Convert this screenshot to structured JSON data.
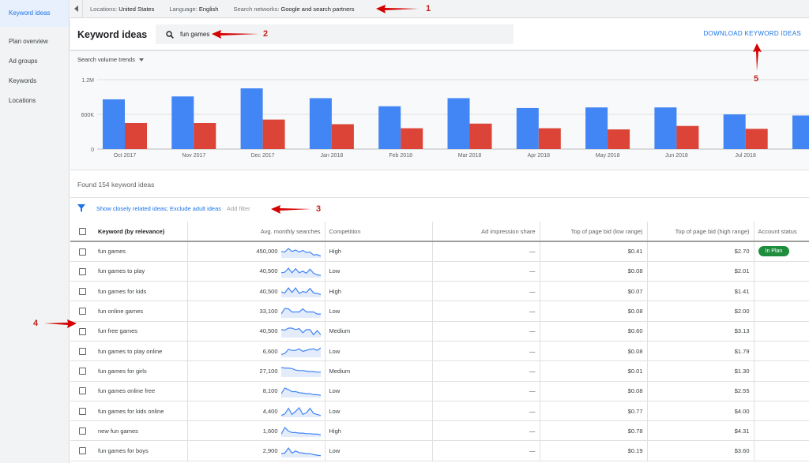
{
  "sidebar": {
    "items": [
      {
        "label": "Keyword ideas",
        "active": true
      },
      {
        "label": "Plan overview",
        "active": false
      },
      {
        "label": "Ad groups",
        "active": false
      },
      {
        "label": "Keywords",
        "active": false
      },
      {
        "label": "Locations",
        "active": false
      }
    ]
  },
  "topbar": {
    "locations_label": "Locations:",
    "locations_value": "United States",
    "language_label": "Language:",
    "language_value": "English",
    "networks_label": "Search networks:",
    "networks_value": "Google and search partners"
  },
  "header": {
    "title": "Keyword ideas",
    "search_value": "fun games",
    "download_label": "DOWNLOAD KEYWORD IDEAS"
  },
  "chart_section": {
    "dropdown_label": "Search volume trends",
    "colors": {
      "blue": "#4285f4",
      "red": "#db4437"
    }
  },
  "chart_data": {
    "type": "bar",
    "categories": [
      "Oct 2017",
      "Nov 2017",
      "Dec 2017",
      "Jan 2018",
      "Feb 2018",
      "Mar 2018",
      "Apr 2018",
      "May 2018",
      "Jun 2018",
      "Jul 2018",
      "Au"
    ],
    "series": [
      {
        "values": [
          860000,
          910000,
          1050000,
          880000,
          740000,
          880000,
          710000,
          720000,
          720000,
          600000,
          580000
        ]
      },
      {
        "values": [
          450000,
          450000,
          510000,
          430000,
          360000,
          440000,
          360000,
          340000,
          400000,
          350000,
          null
        ]
      }
    ],
    "y_ticks": [
      "1.2M",
      "600K",
      "0"
    ],
    "ylim": [
      0,
      1200000
    ]
  },
  "results": {
    "found_text": "Found 154 keyword ideas",
    "filter_text": "Show closely related ideas; Exclude adult ideas",
    "add_filter": "Add filter"
  },
  "table": {
    "headers": {
      "keyword": "Keyword (by relevance)",
      "searches": "Avg. monthly searches",
      "competition": "Competition",
      "impression": "Ad impression share",
      "bid_low": "Top of page bid (low range)",
      "bid_high": "Top of page bid (high range)",
      "account": "Account status"
    },
    "rows": [
      {
        "keyword": "fun games",
        "searches": "450,000",
        "competition": "High",
        "impression": "—",
        "bid_low": "$0.41",
        "bid_high": "$2.70",
        "account": "In Plan",
        "trend": [
          0.55,
          0.5,
          0.85,
          0.55,
          0.7,
          0.5,
          0.65,
          0.45,
          0.5,
          0.2,
          0.25,
          0.1
        ]
      },
      {
        "keyword": "fun games to play",
        "searches": "40,500",
        "competition": "Low",
        "impression": "—",
        "bid_low": "$0.08",
        "bid_high": "$2.01",
        "account": "",
        "trend": [
          0.4,
          0.45,
          0.85,
          0.4,
          0.8,
          0.4,
          0.55,
          0.35,
          0.75,
          0.35,
          0.2,
          0.15
        ]
      },
      {
        "keyword": "fun games for kids",
        "searches": "40,500",
        "competition": "High",
        "impression": "—",
        "bid_low": "$0.07",
        "bid_high": "$1.41",
        "account": "",
        "trend": [
          0.45,
          0.35,
          0.85,
          0.4,
          0.85,
          0.3,
          0.5,
          0.4,
          0.8,
          0.35,
          0.3,
          0.2
        ]
      },
      {
        "keyword": "fun online games",
        "searches": "33,100",
        "competition": "Low",
        "impression": "—",
        "bid_low": "$0.08",
        "bid_high": "$2.00",
        "account": "",
        "trend": [
          0.3,
          0.85,
          0.8,
          0.5,
          0.5,
          0.5,
          0.8,
          0.5,
          0.5,
          0.5,
          0.3,
          0.3
        ]
      },
      {
        "keyword": "fun free games",
        "searches": "40,500",
        "competition": "Medium",
        "impression": "—",
        "bid_low": "$0.60",
        "bid_high": "$3.13",
        "account": "",
        "trend": [
          0.7,
          0.65,
          0.85,
          0.85,
          0.7,
          0.8,
          0.4,
          0.7,
          0.7,
          0.2,
          0.6,
          0.2
        ]
      },
      {
        "keyword": "fun games to play online",
        "searches": "6,600",
        "competition": "Low",
        "impression": "—",
        "bid_low": "$0.08",
        "bid_high": "$1.79",
        "account": "",
        "trend": [
          0.2,
          0.3,
          0.7,
          0.6,
          0.6,
          0.75,
          0.5,
          0.6,
          0.7,
          0.75,
          0.6,
          0.85
        ]
      },
      {
        "keyword": "fun games for girls",
        "searches": "27,100",
        "competition": "Medium",
        "impression": "—",
        "bid_low": "$0.01",
        "bid_high": "$1.30",
        "account": "",
        "trend": [
          0.85,
          0.8,
          0.8,
          0.75,
          0.6,
          0.55,
          0.55,
          0.5,
          0.45,
          0.45,
          0.4,
          0.4
        ]
      },
      {
        "keyword": "fun games online free",
        "searches": "8,100",
        "competition": "Low",
        "impression": "—",
        "bid_low": "$0.08",
        "bid_high": "$2.55",
        "account": "",
        "trend": [
          0.3,
          0.85,
          0.7,
          0.5,
          0.5,
          0.4,
          0.35,
          0.3,
          0.3,
          0.2,
          0.2,
          0.15
        ]
      },
      {
        "keyword": "fun games for kids online",
        "searches": "4,400",
        "competition": "Low",
        "impression": "—",
        "bid_low": "$0.77",
        "bid_high": "$4.00",
        "account": "",
        "trend": [
          0.1,
          0.25,
          0.8,
          0.2,
          0.5,
          0.85,
          0.2,
          0.35,
          0.8,
          0.3,
          0.2,
          0.1
        ]
      },
      {
        "keyword": "new fun games",
        "searches": "1,600",
        "competition": "High",
        "impression": "—",
        "bid_low": "$0.78",
        "bid_high": "$4.31",
        "account": "",
        "trend": [
          0.2,
          0.85,
          0.5,
          0.35,
          0.35,
          0.3,
          0.3,
          0.25,
          0.25,
          0.2,
          0.2,
          0.15
        ]
      },
      {
        "keyword": "fun games for boys",
        "searches": "2,900",
        "competition": "Low",
        "impression": "—",
        "bid_low": "$0.19",
        "bid_high": "$3.60",
        "account": "",
        "trend": [
          0.3,
          0.35,
          0.85,
          0.35,
          0.55,
          0.4,
          0.35,
          0.3,
          0.3,
          0.2,
          0.15,
          0.1
        ]
      }
    ]
  },
  "annotations": [
    "1",
    "2",
    "3",
    "4",
    "5"
  ]
}
